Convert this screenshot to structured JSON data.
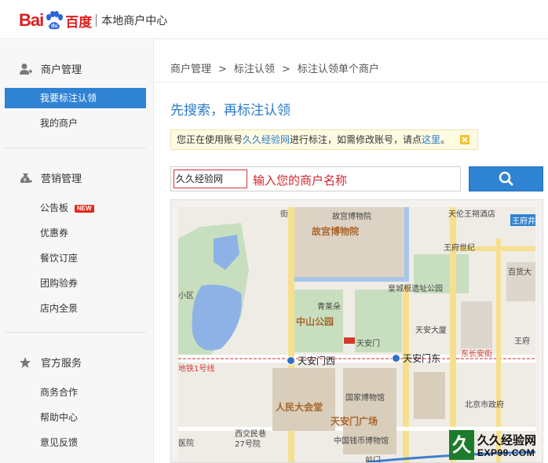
{
  "header": {
    "logo_bai": "Bai",
    "logo_du": "du",
    "logo_baidu": "百度",
    "subtitle": "本地商户中心",
    "brand_color": "#de1e1e"
  },
  "sidebar": {
    "groups": [
      {
        "title": "商户管理",
        "icon": "user-manage-icon",
        "items": [
          {
            "label": "我要标注认领",
            "active": true
          },
          {
            "label": "我的商户"
          }
        ]
      },
      {
        "title": "营销管理",
        "icon": "money-bag-icon",
        "items": [
          {
            "label": "公告板",
            "badge": "NEW"
          },
          {
            "label": "优惠券"
          },
          {
            "label": "餐饮订座"
          },
          {
            "label": "团购验券"
          },
          {
            "label": "店内全景"
          }
        ]
      },
      {
        "title": "官方服务",
        "icon": "star-icon",
        "items": [
          {
            "label": "商务合作"
          },
          {
            "label": "帮助中心"
          },
          {
            "label": "意见反馈"
          }
        ]
      }
    ],
    "accent": "#2f83d3"
  },
  "breadcrumb": {
    "items": [
      "商户管理",
      "标注认领",
      "标注认领单个商户"
    ],
    "separator": ">"
  },
  "page": {
    "title": "先搜索，再标注认领"
  },
  "notice": {
    "prefix": "您正在使用账号",
    "account": "久久经验网",
    "middle": "进行标注，如需修改账号，请点",
    "link": "这里",
    "suffix": "。"
  },
  "search": {
    "value": "久久经验网",
    "hint": "输入您的商户名称",
    "button_icon": "search-icon"
  },
  "map": {
    "labels": {
      "palace_museum": "故宫博物院",
      "palace_museum_big": "故宫博物院",
      "tianlun": "天伦王朔酒店",
      "wangfujing": "王府井",
      "wangfu_century": "王府世纪",
      "department_store": "百货大",
      "xiaoqu": "小区",
      "huangcheng": "皇城根遗址公园",
      "qinglaiduo": "青莱朵",
      "zhongshan_park": "中山公园",
      "tiananmen": "天安门",
      "tianan_building": "天安大厦",
      "wangfu2": "王府",
      "line1": "地铁1号线",
      "line1_right": "东长安街",
      "tiananmen_west": "天安门西",
      "tiananmen_east": "天安门东",
      "national_museum": "国家博物馆",
      "great_hall": "人民大会堂",
      "square": "天安门广场",
      "beijing_gov": "北京市政府",
      "xijiaominxiang": "西交民巷27号院",
      "qianmen_currency": "中国钱币博物馆",
      "hospital": "医院",
      "jie": "街",
      "qianmen": "前门"
    }
  },
  "watermark": {
    "char": "久",
    "title": "久久经验网",
    "url": "EXP99.COM"
  }
}
